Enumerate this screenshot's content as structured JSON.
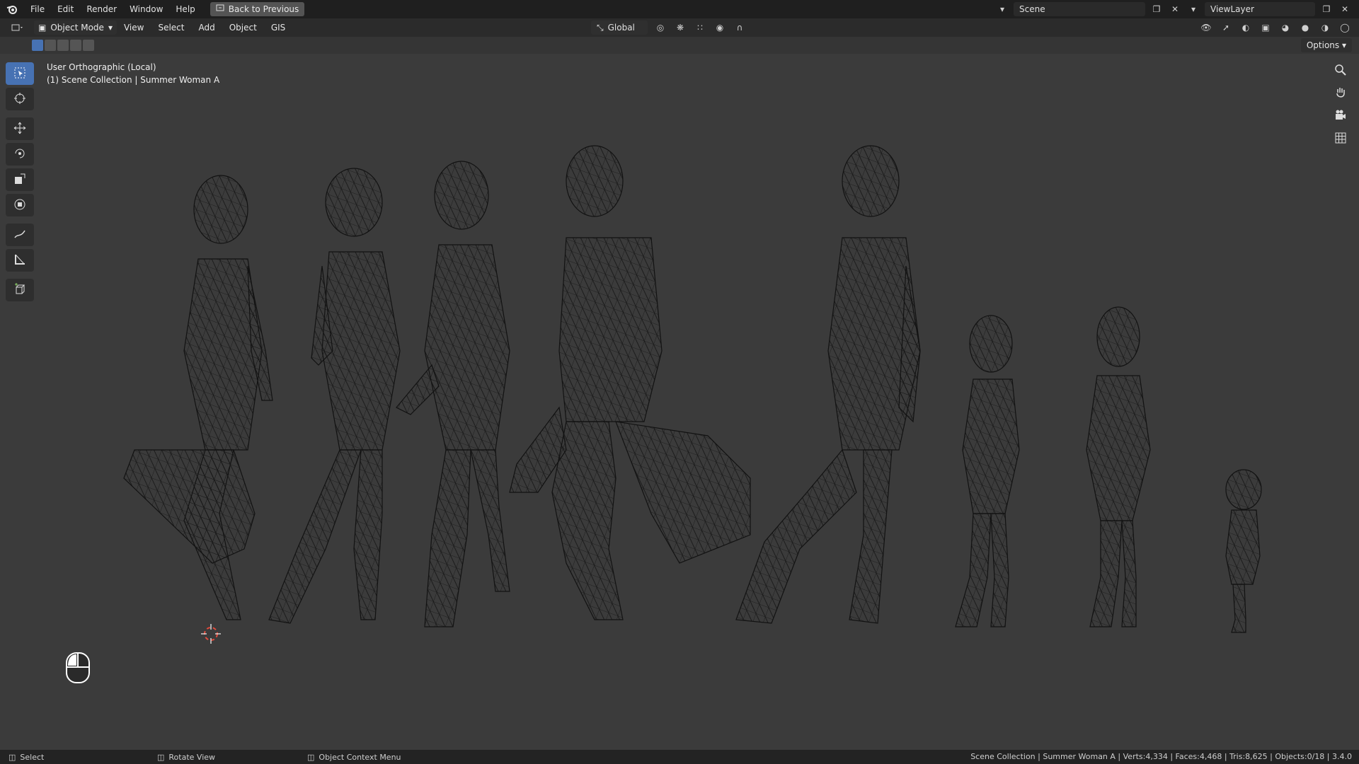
{
  "topbar": {
    "menus": [
      "File",
      "Edit",
      "Render",
      "Window",
      "Help"
    ],
    "back_label": "Back to Previous",
    "scene_name": "Scene",
    "viewlayer_name": "ViewLayer"
  },
  "viewport_header": {
    "mode": "Object Mode",
    "menus": [
      "View",
      "Select",
      "Add",
      "Object",
      "GIS"
    ],
    "transform_orientation": "Global",
    "options_label": "Options"
  },
  "viewport": {
    "view_name": "User Orthographic (Local)",
    "collection_label": "(1) Scene Collection | Summer Woman A"
  },
  "statusbar": {
    "select": "Select",
    "rotate": "Rotate View",
    "context": "Object Context Menu",
    "stats": "Scene Collection | Summer Woman A | Verts:4,334 | Faces:4,468 | Tris:8,625 | Objects:0/18 | 3.4.0"
  },
  "colors": {
    "topbar": "#1f1f1f",
    "header": "#2b2b2b",
    "viewport": "#3b3b3b",
    "accent": "#4772b3",
    "wire": "#111111"
  }
}
